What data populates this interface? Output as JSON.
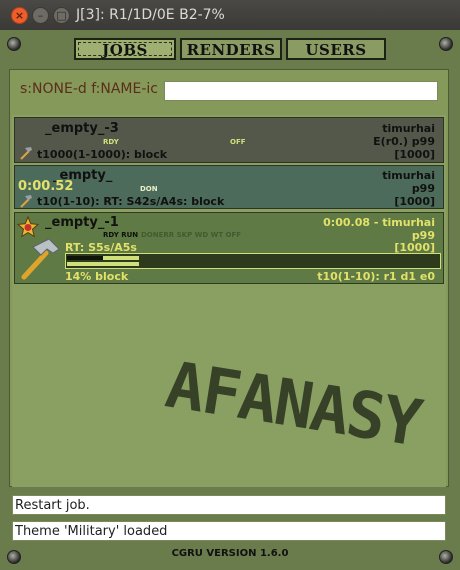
{
  "window": {
    "title": "J[3]: R1/1D/0E B2-7%"
  },
  "tabs": [
    {
      "label": "JOBS",
      "active": true
    },
    {
      "label": "RENDERS",
      "active": false
    },
    {
      "label": "USERS",
      "active": false
    }
  ],
  "filter": {
    "label": "s:NONE-d f:NAME-ic",
    "value": ""
  },
  "jobs": [
    {
      "name": "_empty_-3",
      "user": "timurhai",
      "state_flags": "RDY",
      "state_flags_2": "OFF",
      "priority": "E(r0.) p99",
      "block": "t1000(1-1000): block",
      "tasks": "[1000]"
    },
    {
      "name": "_empty_",
      "time": "0:00.52",
      "user": "timurhai",
      "state_flags": "DON",
      "priority": "p99",
      "block": "t10(1-10): RT: S42s/A4s: block",
      "tasks": "[1000]"
    },
    {
      "name": "_empty_-1",
      "state_flags": "RDY RUN",
      "state_flags_dim": "DONERR SKP WD  WT  OFF",
      "time_user": "0:00.08 - timurhai",
      "priority": "p99",
      "rt": "RT: S5s/A5s",
      "tasks": "[1000]",
      "progress_label": "14% block",
      "progress": 14,
      "tasks_info": "t10(1-10): r1 d1 e0"
    }
  ],
  "watermark": "AFANASY",
  "status_lines": [
    "Restart job.",
    "Theme 'Military' loaded"
  ],
  "footer": {
    "version": "CGRU VERSION 1.6.0"
  },
  "colors": {
    "accent_light": "#cfe07a",
    "job_time": "#e2e26a",
    "running_bg": "#5f7a44"
  }
}
